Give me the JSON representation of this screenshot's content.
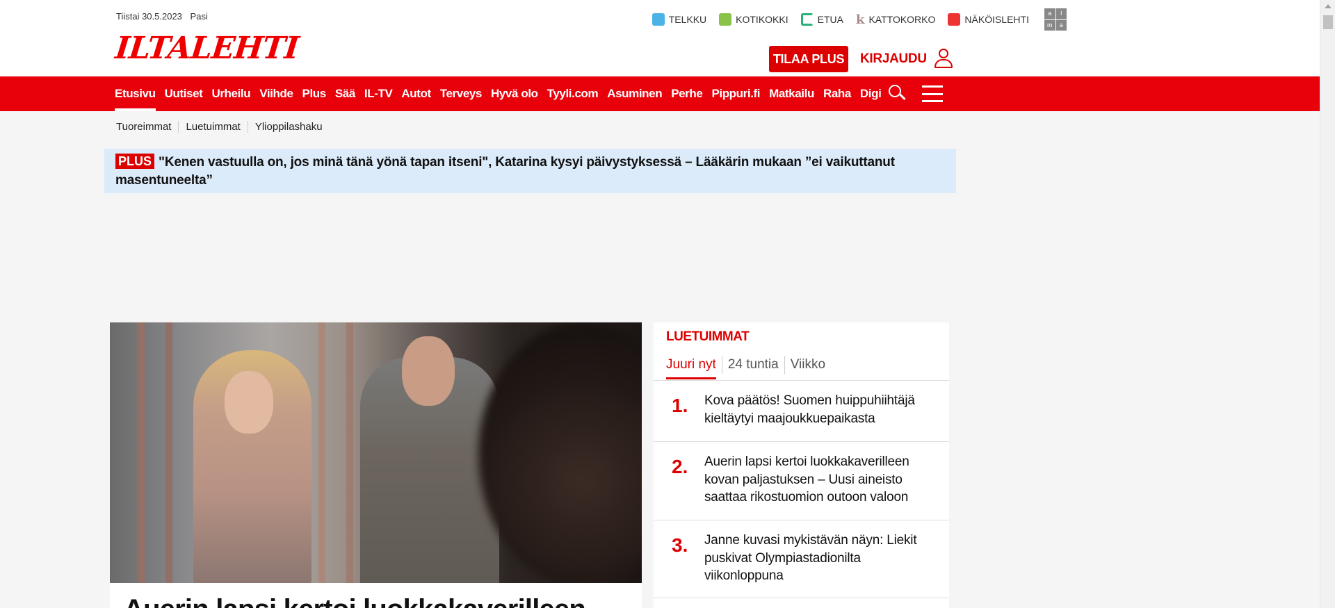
{
  "header": {
    "date": "Tiistai 30.5.2023",
    "user_name": "Pasi",
    "logo_text": "ILTALEHTI",
    "services": [
      {
        "label": "TELKKU",
        "icon": "telkku-icon"
      },
      {
        "label": "KOTIKOKKI",
        "icon": "kotikokki-icon"
      },
      {
        "label": "ETUA",
        "icon": "etua-icon"
      },
      {
        "label": "KATTOKORKO",
        "icon": "kattokorko-icon"
      },
      {
        "label": "NÄKÖISLEHTI",
        "icon": "nakoislehti-icon"
      }
    ],
    "alma_logo": "alma",
    "subscribe_label": "TILAA PLUS",
    "login_label": "KIRJAUDU"
  },
  "nav": {
    "items": [
      "Etusivu",
      "Uutiset",
      "Urheilu",
      "Viihde",
      "Plus",
      "Sää",
      "IL-TV",
      "Autot",
      "Terveys",
      "Hyvä olo",
      "Tyyli.com",
      "Asuminen",
      "Perhe",
      "Pippuri.fi",
      "Matkailu",
      "Raha",
      "Digi"
    ],
    "active": "Etusivu"
  },
  "subnav": {
    "items": [
      "Tuoreimmat",
      "Luetuimmat",
      "Ylioppilashaku"
    ]
  },
  "plus_banner": {
    "tag": "PLUS",
    "text": "\"Kenen vastuulla on, jos minä tänä yönä tapan itseni\", Katarina kysyi päivystyksessä – Lääkärin mukaan ”ei vaikuttanut masentuneelta”"
  },
  "main_article": {
    "headline": "Auerin lapsi kertoi luokkakaverilleen"
  },
  "most_read": {
    "title": "LUETUIMMAT",
    "tabs": [
      "Juuri nyt",
      "24 tuntia",
      "Viikko"
    ],
    "active_tab": "Juuri nyt",
    "items": [
      {
        "rank": "1.",
        "text": "Kova päätös! Suomen huippuhiihtäjä kieltäytyi maajoukkuepaikasta"
      },
      {
        "rank": "2.",
        "text": "Auerin lapsi kertoi luokkakaverilleen kovan paljastuksen – Uusi aineisto saattaa rikostuomion outoon valoon"
      },
      {
        "rank": "3.",
        "text": "Janne kuvasi mykistävän näyn: Liekit puskivat Olympiastadionilta viikonloppuna"
      }
    ]
  },
  "colors": {
    "brand_red": "#e8000b",
    "plus_banner_bg": "#dcebfa",
    "page_bg": "#f5f5f5"
  }
}
